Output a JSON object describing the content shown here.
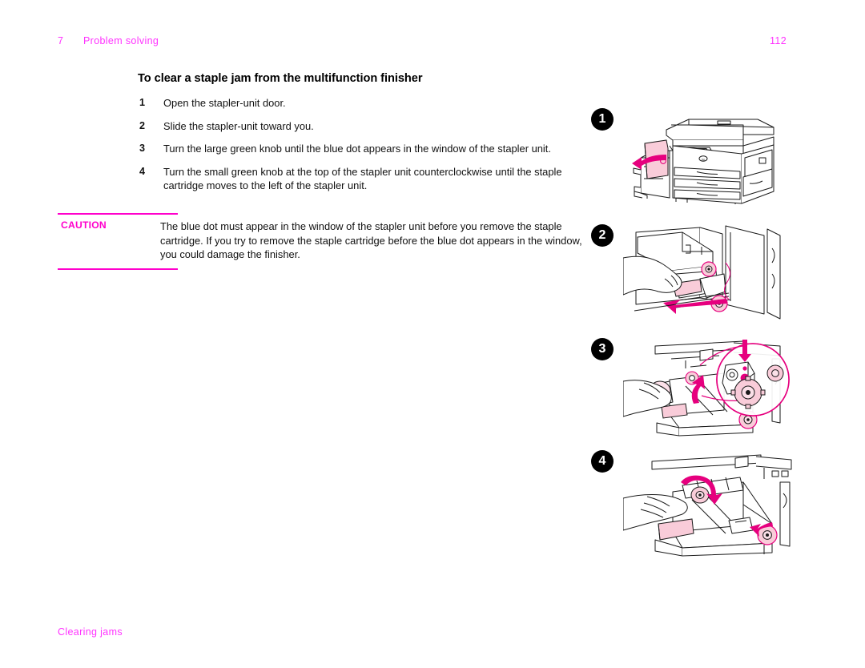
{
  "header": {
    "chapter_number": "7",
    "chapter_name": "Problem solving",
    "page_number": "112",
    "accent_color": "#ff33ff"
  },
  "section": {
    "title": "To clear a staple jam from the multifunction finisher"
  },
  "steps": [
    {
      "number": "1",
      "text": "Open the stapler-unit door."
    },
    {
      "number": "2",
      "text": "Slide the stapler-unit toward you."
    },
    {
      "number": "3",
      "text": "Turn the large green knob until the blue dot appears in the window of the stapler unit."
    },
    {
      "number": "4",
      "text": "Turn the small green knob at the top of the stapler unit counterclockwise until the staple cartridge moves to the left of the stapler unit."
    }
  ],
  "caution": {
    "label": "CAUTION",
    "text": "The blue dot must appear in the window of the stapler unit before you remove the staple cartridge. If you try to remove the staple cartridge before the blue dot appears in the window, you could damage the finisher.",
    "rule_color": "#ff00cc",
    "label_color": "#ff00cc"
  },
  "footer": {
    "text": "Clearing jams",
    "accent_color": "#ff33ff"
  },
  "illustrations": [
    {
      "badge": "1",
      "caption_ref": "Open the stapler-unit door.",
      "description": "Multifunction printer with attached finisher; finisher stapler-unit door swings open, highlighted pink, with a magenta curved arrow pointing left."
    },
    {
      "badge": "2",
      "caption_ref": "Slide the stapler-unit toward you.",
      "description": "Close-up inside the open finisher door: a hand grips the pink stapler-unit handle while a large magenta arrow points down-left toward the viewer."
    },
    {
      "badge": "3",
      "caption_ref": "Turn the large green knob until the blue dot appears.",
      "description": "Close-up of stapler unit with hand on the large knob, a magenta rotation arrow, and a magenta magnifier circle callout showing the indicator window with the dot and a down arrow."
    },
    {
      "badge": "4",
      "caption_ref": "Turn the small green knob counterclockwise.",
      "description": "Close-up of stapler unit with a hand turning the small top knob, a magenta rotation arrow at the knob, a magenta arrow at the right showing cartridge travel, and the pink staple cartridge at the left."
    }
  ],
  "palette": {
    "line": "#1a1a1a",
    "magenta": "#e6007e",
    "pink_fill": "#f9ccd9",
    "pink_fill_light": "#fbe0e8",
    "header_magenta": "#ff33ff"
  }
}
